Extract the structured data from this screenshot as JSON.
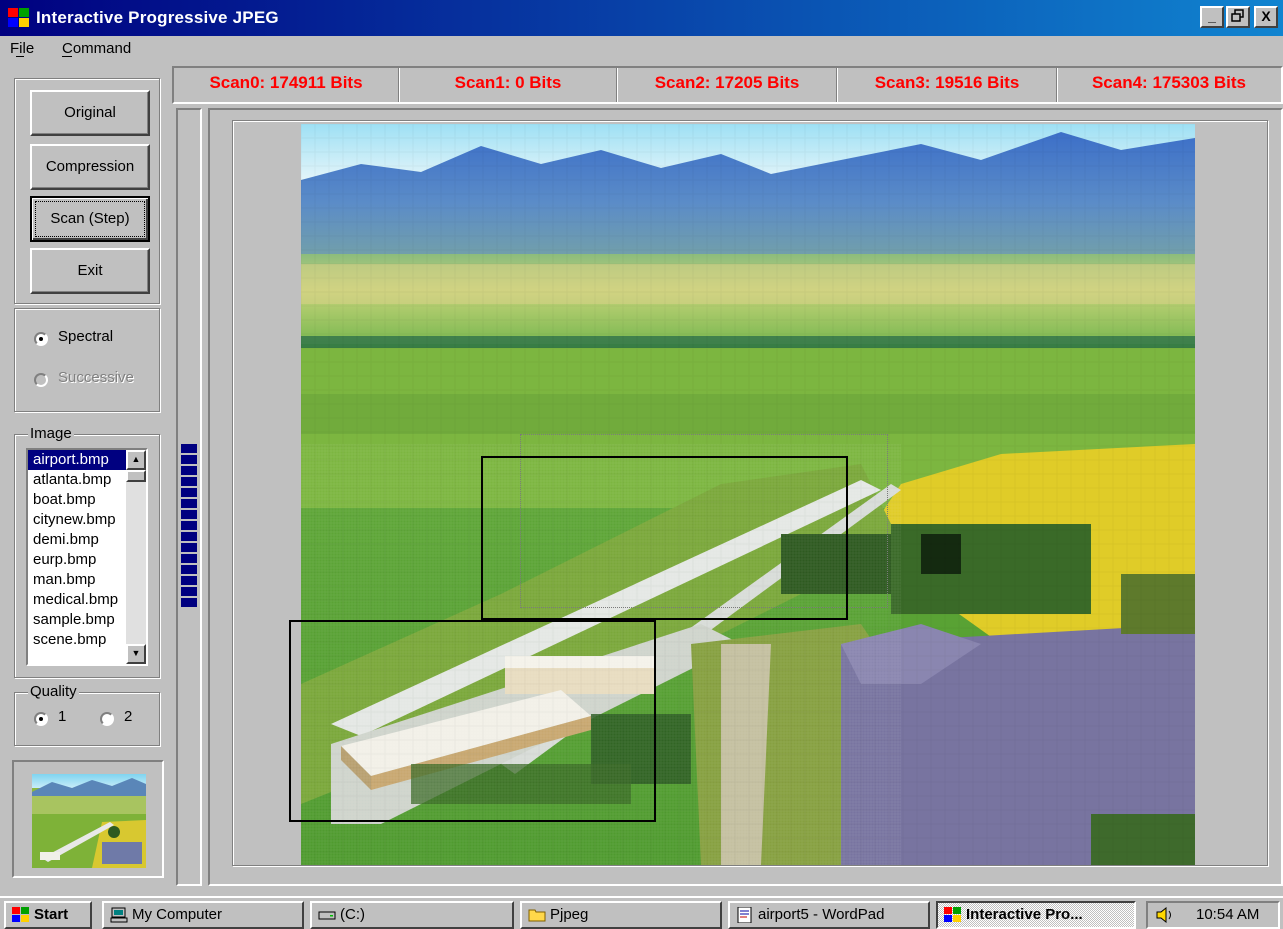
{
  "window": {
    "title": "Interactive Progressive JPEG",
    "controls": [
      "_",
      "▣",
      "X"
    ]
  },
  "menu": [
    "File",
    "Command"
  ],
  "buttons": {
    "original": "Original",
    "compression": "Compression",
    "scan_step": "Scan (Step)",
    "exit": "Exit"
  },
  "mode": {
    "spectral": "Spectral",
    "successive": "Successive",
    "selected": "Spectral"
  },
  "image_group": {
    "label": "Image",
    "files": [
      "airport.bmp",
      "atlanta.bmp",
      "boat.bmp",
      "citynew.bmp",
      "demi.bmp",
      "eurp.bmp",
      "man.bmp",
      "medical.bmp",
      "sample.bmp",
      "scene.bmp"
    ],
    "selected": "airport.bmp"
  },
  "quality": {
    "label": "Quality",
    "opt1": "1",
    "opt2": "2",
    "selected": "1"
  },
  "scans": [
    "Scan0: 174911 Bits",
    "Scan1: 0 Bits",
    "Scan2: 17205 Bits",
    "Scan3: 19516 Bits",
    "Scan4: 175303 Bits"
  ],
  "progress": {
    "filled_blocks": 15
  },
  "taskbar": {
    "start": "Start",
    "items": [
      "My Computer",
      "(C:)",
      "Pjpeg",
      "airport5 - WordPad",
      "Interactive Pro..."
    ],
    "clock": "10:54 AM"
  },
  "colors": {
    "titlebar": "#000080",
    "scan_text": "#ff0000",
    "progress": "#000080",
    "face": "#c0c0c0"
  }
}
